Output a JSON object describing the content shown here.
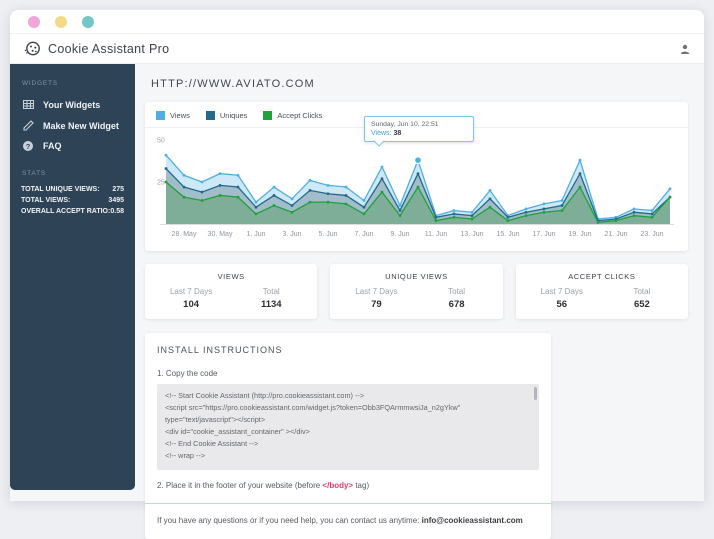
{
  "window": {
    "traffic_light_colors": [
      "#f0a6d8",
      "#f3d98a",
      "#74c6c4"
    ]
  },
  "header": {
    "app_title": "Cookie Assistant Pro"
  },
  "sidebar": {
    "widgets_header": "WIDGETS",
    "items": [
      {
        "label": "Your Widgets"
      },
      {
        "label": "Make New Widget"
      },
      {
        "label": "FAQ"
      }
    ],
    "stats_header": "STATS",
    "stats": [
      {
        "label": "TOTAL UNIQUE VIEWS:",
        "value": "275"
      },
      {
        "label": "TOTAL VIEWS:",
        "value": "3495"
      },
      {
        "label": "OVERALL ACCEPT RATIO:",
        "value": "0.58"
      }
    ]
  },
  "main": {
    "site_url": "HTTP://WWW.AVIATO.COM",
    "tooltip": {
      "title": "Sunday, Jun 10, 22:51",
      "series_label": "Views:",
      "value": "38"
    },
    "cards": [
      {
        "title": "VIEWS",
        "col1_label": "Last 7 Days",
        "col1_value": "104",
        "col2_label": "Total",
        "col2_value": "1134"
      },
      {
        "title": "UNIQUE VIEWS",
        "col1_label": "Last 7 Days",
        "col1_value": "79",
        "col2_label": "Total",
        "col2_value": "678"
      },
      {
        "title": "ACCEPT CLICKS",
        "col1_label": "Last 7 Days",
        "col1_value": "56",
        "col2_label": "Total",
        "col2_value": "652"
      }
    ],
    "install": {
      "title": "INSTALL INSTRUCTIONS",
      "step1": "1. Copy the code",
      "code_lines": [
        "<!-- Start Cookie Assistant (http://pro.cookieassistant.com) -->",
        "<script src=\"https://pro.cookieassistant.com/widget.js?token=Obb3FQArmmwsiJa_n2gYkw\"",
        "type=\"text/javascript\"></script>",
        "<div id=\"cookie_assistant_container\" ></div>",
        "<!-- End Cookie Assistant -->",
        "<!-- wrap -->"
      ],
      "step2_prefix": "2. Place it in the footer of your website (before ",
      "step2_code": "</body>",
      "step2_suffix": " tag)",
      "contact_prefix": "If you have any questions or if you need help, you can contact us anytime: ",
      "contact_email": "info@cookieassistant.com"
    }
  },
  "chart_data": {
    "type": "area",
    "title": "Daily traffic: views, uniques and accept clicks",
    "xlabel": "",
    "ylabel": "",
    "ylim": [
      0,
      50
    ],
    "yticks": [
      25,
      50
    ],
    "grid": false,
    "legend_position": "top-left",
    "dates": [
      "27. May",
      "28. May",
      "29. May",
      "30. May",
      "31. May",
      "1. Jun",
      "2. Jun",
      "3. Jun",
      "4. Jun",
      "5. Jun",
      "6. Jun",
      "7. Jun",
      "8. Jun",
      "9. Jun",
      "10. Jun",
      "11. Jun",
      "12. Jun",
      "13. Jun",
      "14. Jun",
      "15. Jun",
      "16. Jun",
      "17. Jun",
      "18. Jun",
      "19. Jun",
      "20. Jun",
      "21. Jun",
      "22. Jun",
      "23. Jun",
      "24. Jun"
    ],
    "x_tick_labels": [
      "28. May",
      "30. May",
      "1. Jun",
      "3. Jun",
      "5. Jun",
      "7. Jun",
      "9. Jun",
      "11. Jun",
      "13. Jun",
      "15. Jun",
      "17. Jun",
      "19. Jun",
      "21. Jun",
      "23. Jun"
    ],
    "series": [
      {
        "name": "Views",
        "color": "#4fb0e0",
        "fill": "#c9e6f6",
        "values": [
          41,
          29,
          25,
          30,
          29,
          13,
          22,
          15,
          26,
          23,
          22,
          14,
          34,
          11,
          38,
          5,
          8,
          7,
          20,
          5,
          9,
          12,
          14,
          38,
          3,
          4,
          9,
          8,
          21
        ]
      },
      {
        "name": "Uniques",
        "color": "#25688a",
        "fill": "#9db9c6",
        "values": [
          33,
          22,
          19,
          23,
          22,
          10,
          17,
          11,
          20,
          18,
          17,
          10,
          27,
          8,
          30,
          4,
          6,
          5,
          15,
          4,
          7,
          9,
          11,
          30,
          2,
          3,
          7,
          6,
          16
        ]
      },
      {
        "name": "Accept Clicks",
        "color": "#1fa13c",
        "fill": "#7cab94",
        "values": [
          25,
          16,
          14,
          17,
          16,
          6,
          11,
          7,
          13,
          13,
          12,
          6,
          19,
          5,
          22,
          2,
          4,
          3,
          10,
          2,
          5,
          7,
          8,
          22,
          1,
          2,
          5,
          4,
          16
        ]
      }
    ],
    "tooltip_point": {
      "index": 14,
      "date": "10. Jun",
      "series": "Views",
      "value": 38
    }
  }
}
